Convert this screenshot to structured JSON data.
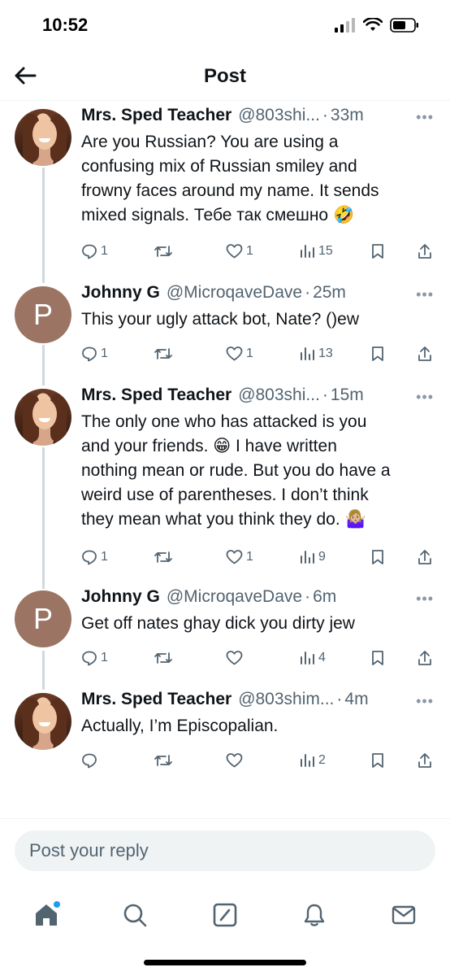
{
  "status_bar": {
    "time": "10:52"
  },
  "nav": {
    "title": "Post"
  },
  "tweets": [
    {
      "author": "Mrs. Sped Teacher",
      "handle": "@803shi...",
      "time": "33m",
      "text": "Are you Russian? You are using a\nconfusing mix of Russian smiley and\nfrowny faces around my name. It sends\nmixed signals. Тебе так смешно 🤣",
      "replies": "1",
      "reposts": "",
      "likes": "1",
      "views": "15",
      "avatar": "photo"
    },
    {
      "author": "Johnny G",
      "handle": "@MicroqaveDave",
      "time": "25m",
      "text": "This your ugly attack bot, Nate? ()ew",
      "replies": "1",
      "reposts": "",
      "likes": "1",
      "views": "13",
      "avatar": "P"
    },
    {
      "author": "Mrs. Sped Teacher",
      "handle": "@803shi...",
      "time": "15m",
      "text": "The only one who has attacked is you\nand your friends. 😁 I have written\nnothing mean or rude. But you do have a\nweird use of parentheses. I don’t think\nthey mean what you think they do. 🤷🏼‍♀️",
      "replies": "1",
      "reposts": "",
      "likes": "1",
      "views": "9",
      "avatar": "photo"
    },
    {
      "author": "Johnny G",
      "handle": "@MicroqaveDave",
      "time": "6m",
      "text": "Get off nates ghay dick you dirty jew",
      "replies": "1",
      "reposts": "",
      "likes": "",
      "views": "4",
      "avatar": "P"
    },
    {
      "author": "Mrs. Sped Teacher",
      "handle": "@803shim...",
      "time": "4m",
      "text": "Actually, I’m Episcopalian.",
      "replies": "",
      "reposts": "",
      "likes": "",
      "views": "2",
      "avatar": "photo"
    }
  ],
  "reply": {
    "placeholder": "Post your reply"
  },
  "tabs": [
    "home-icon",
    "search-icon",
    "grok-icon",
    "notifications-icon",
    "messages-icon"
  ],
  "colors": {
    "accent": "#1d9bf0",
    "muted": "#536471",
    "thread_line": "#cfd9de"
  }
}
